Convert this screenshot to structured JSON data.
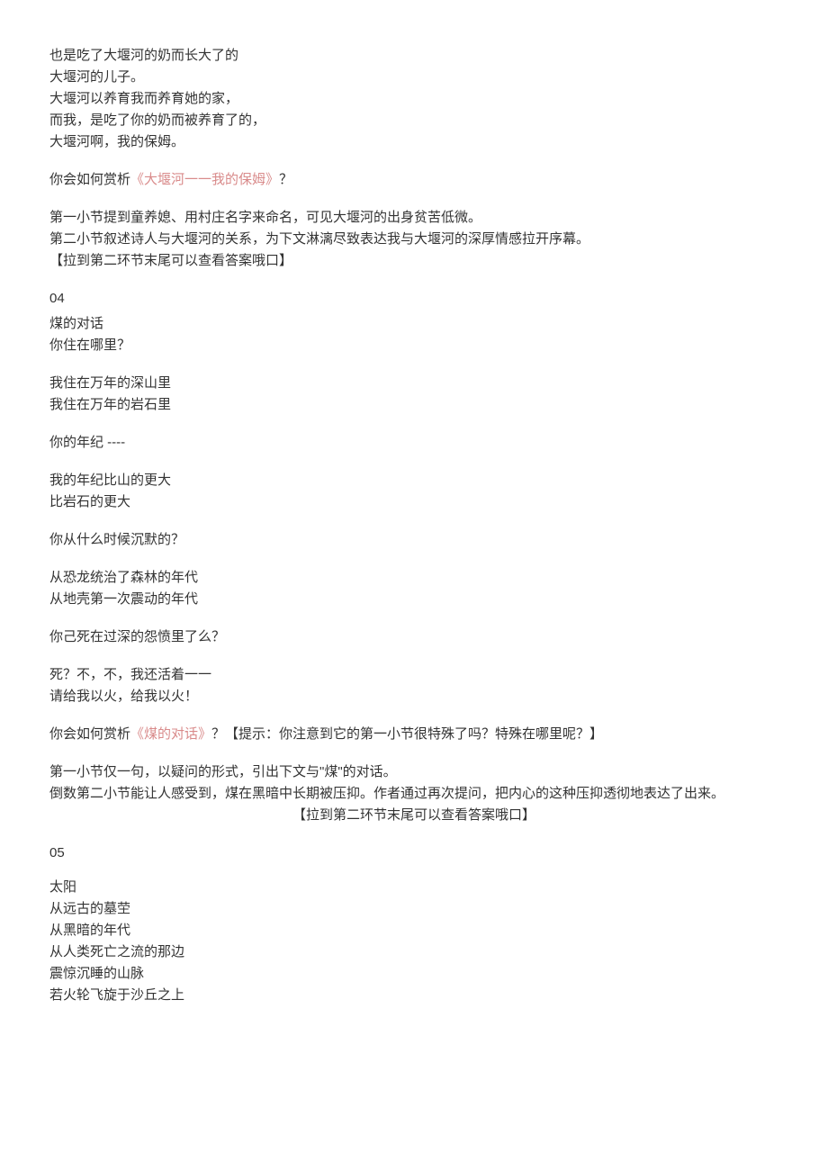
{
  "section3": {
    "stanza1": [
      "也是吃了大堰河的奶而长大了的",
      "大堰河的儿子。",
      "大堰河以养育我而养育她的家，",
      "而我，是吃了你的奶而被养育了的，",
      "大堰河啊，我的保姆。"
    ],
    "question_pre": "你会如何赏析",
    "question_link": "《大堰河一一我的保姆》",
    "question_post": "？",
    "answer": [
      "第一小节提到童养媳、用村庄名字来命名，可见大堰河的出身贫苦低微。",
      "第二小节叙述诗人与大堰河的关系，为下文淋漓尽致表达我与大堰河的深厚情感拉开序幕。",
      "【拉到第二环节末尾可以查看答案哦口】"
    ]
  },
  "section4": {
    "num": "04",
    "title": "煤的对话",
    "stanza1": [
      "你住在哪里？"
    ],
    "stanza2": [
      "我住在万年的深山里",
      "我住在万年的岩石里"
    ],
    "stanza3": [
      "你的年纪 ----"
    ],
    "stanza4": [
      "我的年纪比山的更大",
      "比岩石的更大"
    ],
    "stanza5": [
      "你从什么时候沉默的？"
    ],
    "stanza6": [
      "从恐龙统治了森林的年代",
      "从地壳第一次震动的年代"
    ],
    "stanza7": [
      "你己死在过深的怨愤里了么？"
    ],
    "stanza8": [
      "死？不，不，我还活着一一",
      "请给我以火，给我以火！"
    ],
    "question_pre": "你会如何赏析",
    "question_link": "《煤的对话》",
    "question_post": "？【提示：你注意到它的第一小节很特殊了吗？特殊在哪里呢？】",
    "answer": [
      "第一小节仅一句，以疑问的形式，引出下文与\"煤\"的对话。",
      "倒数第二小节能让人感受到，煤在黑暗中长期被压抑。作者通过再次提问，把内心的这种压抑透彻地表达了出来。"
    ],
    "answer_hint": "【拉到第二环节末尾可以查看答案哦口】"
  },
  "section5": {
    "num": "05",
    "title": "太阳",
    "stanza1": [
      "从远古的墓茔",
      "从黑暗的年代",
      "从人类死亡之流的那边",
      "震惊沉睡的山脉",
      "若火轮飞旋于沙丘之上"
    ]
  }
}
